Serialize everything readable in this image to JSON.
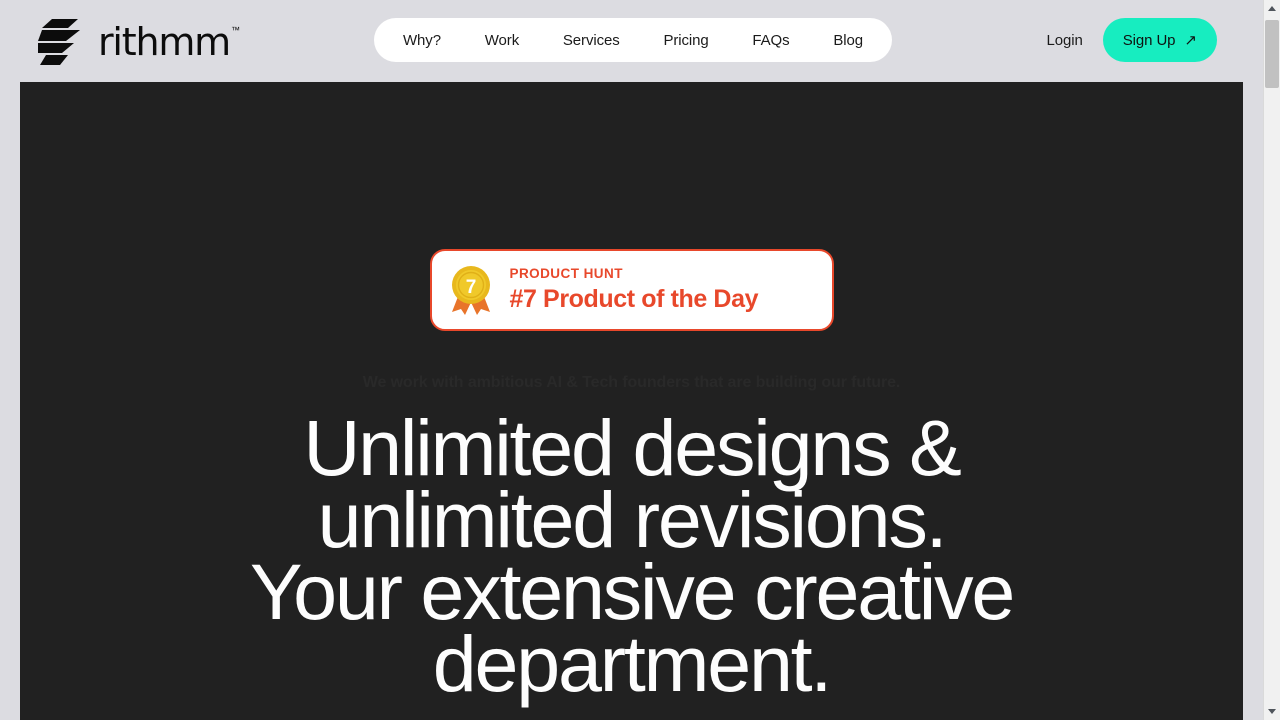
{
  "brand": {
    "name": "rithmm",
    "trademark": "™",
    "logo_icon": "rithmm-stripes-logo"
  },
  "nav": {
    "items": [
      {
        "label": "Why?"
      },
      {
        "label": "Work"
      },
      {
        "label": "Services"
      },
      {
        "label": "Pricing"
      },
      {
        "label": "FAQs"
      },
      {
        "label": "Blog"
      }
    ]
  },
  "header_actions": {
    "login_label": "Login",
    "signup_label": "Sign Up",
    "signup_arrow": "↗",
    "signup_color": "#17edc0"
  },
  "hero": {
    "badge": {
      "eyebrow": "PRODUCT HUNT",
      "title": "#7 Product of the Day",
      "medal_rank": "7",
      "accent_color": "#e8482b",
      "medal_icon": "gold-medal-icon"
    },
    "eyebrow": "We work with ambitious AI & Tech founders that are building our future.",
    "headline_lines": [
      "Unlimited designs &",
      "unlimited revisions.",
      "Your extensive creative",
      "department."
    ],
    "background_color": "#212121",
    "text_color": "#fdfdfd"
  },
  "page": {
    "background_color": "#dcdce1"
  },
  "scrollbar": {
    "up_arrow": "▲",
    "down_arrow": "▼"
  }
}
